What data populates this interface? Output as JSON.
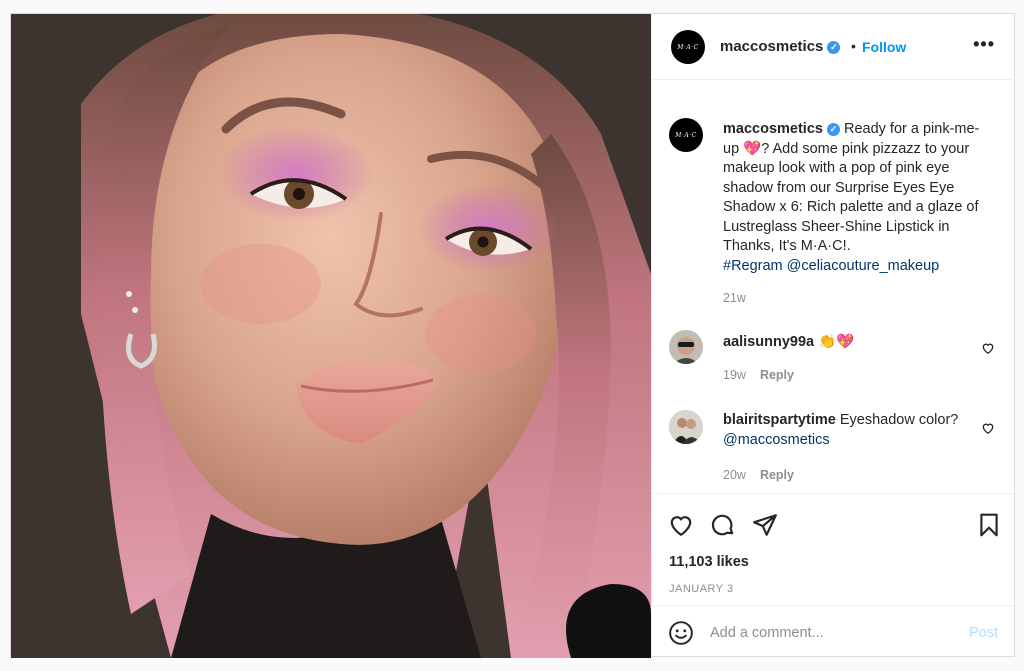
{
  "post": {
    "photo_alt": "",
    "header": {
      "username": "maccosmetics",
      "dot": "•",
      "follow_label": "Follow",
      "more_label": "•••",
      "logo_text": "M·A·C"
    },
    "caption": {
      "username": "maccosmetics",
      "text": " Ready for a pink-me-up 💖? Add some pink pizzazz to your makeup look with a pop of pink eye shadow from our Surprise Eyes Eye Shadow x 6: Rich palette and a glaze of Lustreglass Sheer-Shine Lipstick in Thanks, It's M·A·C!.",
      "tags": "#Regram @celiacouture_makeup",
      "time": "21w"
    },
    "comments": [
      {
        "username": "aalisunny99a",
        "text": " 👏💖",
        "time": "19w",
        "reply_label": "Reply"
      },
      {
        "username": "blairitspartytime",
        "text": " Eyeshadow color? ",
        "mention": "@maccosmetics",
        "time": "20w",
        "reply_label": "Reply"
      }
    ],
    "likes": "11,103 likes",
    "date": "JANUARY 3",
    "add_comment": {
      "placeholder": "Add a comment...",
      "post_label": "Post"
    },
    "colors": {
      "accent": "#0095f6",
      "verified": "#3897f0",
      "link": "#00376b",
      "muted": "#8e8e8e"
    }
  }
}
